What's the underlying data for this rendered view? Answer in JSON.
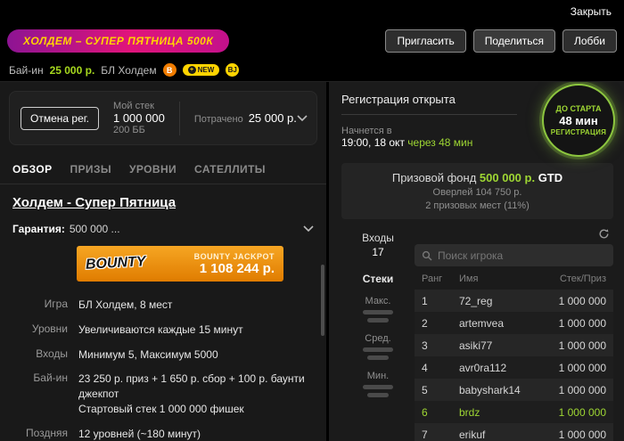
{
  "topbar": {
    "close": "Закрыть"
  },
  "header": {
    "title_badge": "ХОЛДЕМ – СУПЕР ПЯТНИЦА 500К",
    "buttons": {
      "invite": "Пригласить",
      "share": "Поделиться",
      "lobby": "Лобби"
    }
  },
  "subheader": {
    "buyin_label": "Бай-ин",
    "buyin_value": "25 000 р.",
    "game": "БЛ Холдем",
    "badges": {
      "bounty": "B",
      "new": "NEW",
      "bj": "BJ"
    }
  },
  "left": {
    "cancel_button": "Отмена рег.",
    "my_stack_label": "Мой стек",
    "my_stack_value": "1 000 000",
    "my_stack_bb": "200 ББ",
    "spent_label": "Потрачено",
    "spent_value": "25 000 р.",
    "tabs": [
      {
        "label": "ОБЗОР"
      },
      {
        "label": "ПРИЗЫ"
      },
      {
        "label": "УРОВНИ"
      },
      {
        "label": "САТЕЛЛИТЫ"
      }
    ],
    "title": "Холдем - Супер Пятница",
    "guarantee_label": "Гарантия:",
    "guarantee_value": "500 000 ...",
    "bounty": {
      "logo": "BOUNTY",
      "jackpot_label": "BOUNTY JACKPOT",
      "jackpot_value": "1 108 244 р."
    },
    "details": [
      {
        "label": "Игра",
        "value": "БЛ Холдем, 8 мест"
      },
      {
        "label": "Уровни",
        "value": "Увеличиваются каждые 15 минут"
      },
      {
        "label": "Входы",
        "value": "Минимум 5, Максимум 5000"
      },
      {
        "label": "Бай-ин",
        "value": "23 250 р. приз + 1 650 р. сбор + 100 р. баунти джекпот",
        "value2": "Стартовый стек 1 000 000 фишек"
      },
      {
        "label": "Поздняя",
        "value": "12 уровней (~180 минут)"
      }
    ]
  },
  "right": {
    "reg_status": "Регистрация открыта",
    "starts_label": "Начнется в",
    "starts_value": "19:00, 18 окт",
    "starts_in": "через 48 мин",
    "timer": {
      "top": "ДО СТАРТА",
      "mid": "48 мин",
      "bottom": "РЕГИСТРАЦИЯ"
    },
    "prize": {
      "label": "Призовой фонд",
      "value": "500 000 р.",
      "gtd": "GTD",
      "overlay_label": "Оверлей",
      "overlay_value": "104 750 р.",
      "places": "2 призовых мест (11%)"
    },
    "stats": {
      "entries_label": "Входы",
      "entries_value": "17",
      "stacks_label": "Стеки",
      "max_label": "Макс.",
      "avg_label": "Сред.",
      "min_label": "Мин."
    },
    "search_placeholder": "Поиск игрока",
    "table": {
      "headers": [
        "Ранг",
        "Имя",
        "Стек/Приз"
      ],
      "rows": [
        {
          "rank": "1",
          "name": "72_reg",
          "stack": "1 000 000"
        },
        {
          "rank": "2",
          "name": "artemvea",
          "stack": "1 000 000"
        },
        {
          "rank": "3",
          "name": "asiki77",
          "stack": "1 000 000"
        },
        {
          "rank": "4",
          "name": "avr0ra112",
          "stack": "1 000 000"
        },
        {
          "rank": "5",
          "name": "babyshark14",
          "stack": "1 000 000"
        },
        {
          "rank": "6",
          "name": "brdz",
          "stack": "1 000 000"
        },
        {
          "rank": "7",
          "name": "erikuf",
          "stack": "1 000 000"
        }
      ]
    }
  },
  "colors": {
    "accent_green": "#9ed633",
    "badge_magenta": "#e0147b",
    "badge_yellow": "#ffd400",
    "bounty_orange": "#f6a623"
  }
}
